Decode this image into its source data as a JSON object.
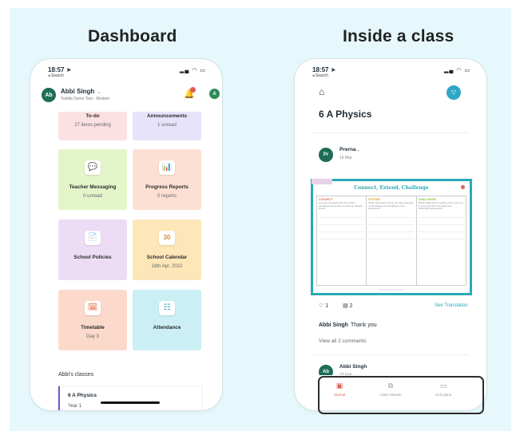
{
  "headings": {
    "left": "Dashboard",
    "right": "Inside a class"
  },
  "status": {
    "time": "18:57",
    "back": "◂ Search"
  },
  "dashboard": {
    "user": {
      "initials": "Ab",
      "name": "Abbi Singh",
      "school": "Toddle Demo Test - Modern",
      "profile_initial": "A"
    },
    "cards": [
      {
        "title": "To-do",
        "meta": "27 items pending"
      },
      {
        "title": "Announcements",
        "meta": "1 unread"
      },
      {
        "title": "Teacher Messaging",
        "meta": "0 unread",
        "icon": "messaging-icon"
      },
      {
        "title": "Progress Reports",
        "meta": "0 reports",
        "icon": "report-icon"
      },
      {
        "title": "School Policies",
        "meta": "",
        "icon": "policy-icon"
      },
      {
        "title": "School Calendar",
        "meta": "18th Apr, 2022",
        "icon": "calendar-icon",
        "icon_text": "30"
      },
      {
        "title": "Timetable",
        "meta": "Day 3",
        "icon": "timetable-icon"
      },
      {
        "title": "Attendance",
        "meta": "",
        "icon": "attendance-icon"
      }
    ],
    "classes_label": "Abbi's classes",
    "class_item": {
      "name": "6 A Physics",
      "year": "Year 1"
    }
  },
  "class_view": {
    "title": "6 A Physics",
    "post": {
      "initials": "Pr",
      "author": "Prerna .",
      "date": "16 Mar"
    },
    "worksheet": {
      "title": "Connect, Extend, Challenge",
      "cols": [
        {
          "h": "CONNECT",
          "t": "How are the ideas and information presented connected to what you already know?"
        },
        {
          "h": "EXTEND",
          "t": "What new ideas did you get that extended or broadened your thinking in new directions?"
        },
        {
          "h": "CHALLENGE",
          "t": "What challenges or puzzles have come up in your mind from the ideas and information presented?"
        }
      ],
      "footer": "www.theeducatorsroom.com"
    },
    "likes": "1",
    "comments_count": "2",
    "see_translation": "See Translation",
    "comment": {
      "author": "Abbi Singh",
      "text": "Thank you"
    },
    "view_all": "View all 2 comments",
    "second_post": {
      "initials": "Ab",
      "author": "Abbi Singh",
      "date": "23 Feb"
    },
    "tabs": [
      {
        "label": "Journal"
      },
      {
        "label": "Class Stream"
      },
      {
        "label": "Unit plans"
      }
    ]
  },
  "colors": {
    "accent": "#2ea7c8",
    "active_tab": "#e05a4e",
    "background": "#e6f8fc"
  }
}
